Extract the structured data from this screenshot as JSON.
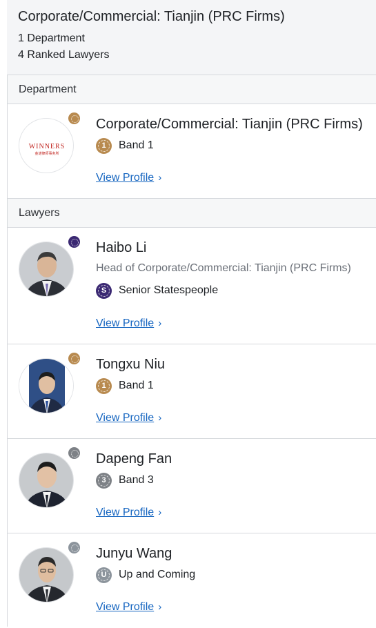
{
  "header": {
    "title": "Corporate/Commercial: Tianjin (PRC Firms)",
    "department_count": "1 Department",
    "lawyer_count": "4 Ranked Lawyers"
  },
  "sections": {
    "department": "Department",
    "lawyers": "Lawyers"
  },
  "department": {
    "name": "Corporate/Commercial: Tianjin (PRC Firms)",
    "band": "Band 1",
    "band_medal": "1",
    "logo_text": "WINNERS",
    "logo_subtext": "金诺律师事务所",
    "link": "View Profile",
    "color": "#b88a4f"
  },
  "lawyers": [
    {
      "name": "Haibo Li",
      "role": "Head of Corporate/Commercial: Tianjin (PRC Firms)",
      "band": "Senior Statespeople",
      "band_medal": "S",
      "link": "View Profile",
      "color": "#3a2872"
    },
    {
      "name": "Tongxu Niu",
      "band": "Band 1",
      "band_medal": "1",
      "link": "View Profile",
      "color": "#b88a4f"
    },
    {
      "name": "Dapeng Fan",
      "band": "Band 3",
      "band_medal": "3",
      "link": "View Profile",
      "color": "#7d8186"
    },
    {
      "name": "Junyu Wang",
      "band": "Up and Coming",
      "band_medal": "U",
      "link": "View Profile",
      "color": "#8c949c"
    }
  ],
  "icons": {
    "chevron": "chevron-right-icon",
    "ranking": "ranking-medal-icon"
  }
}
